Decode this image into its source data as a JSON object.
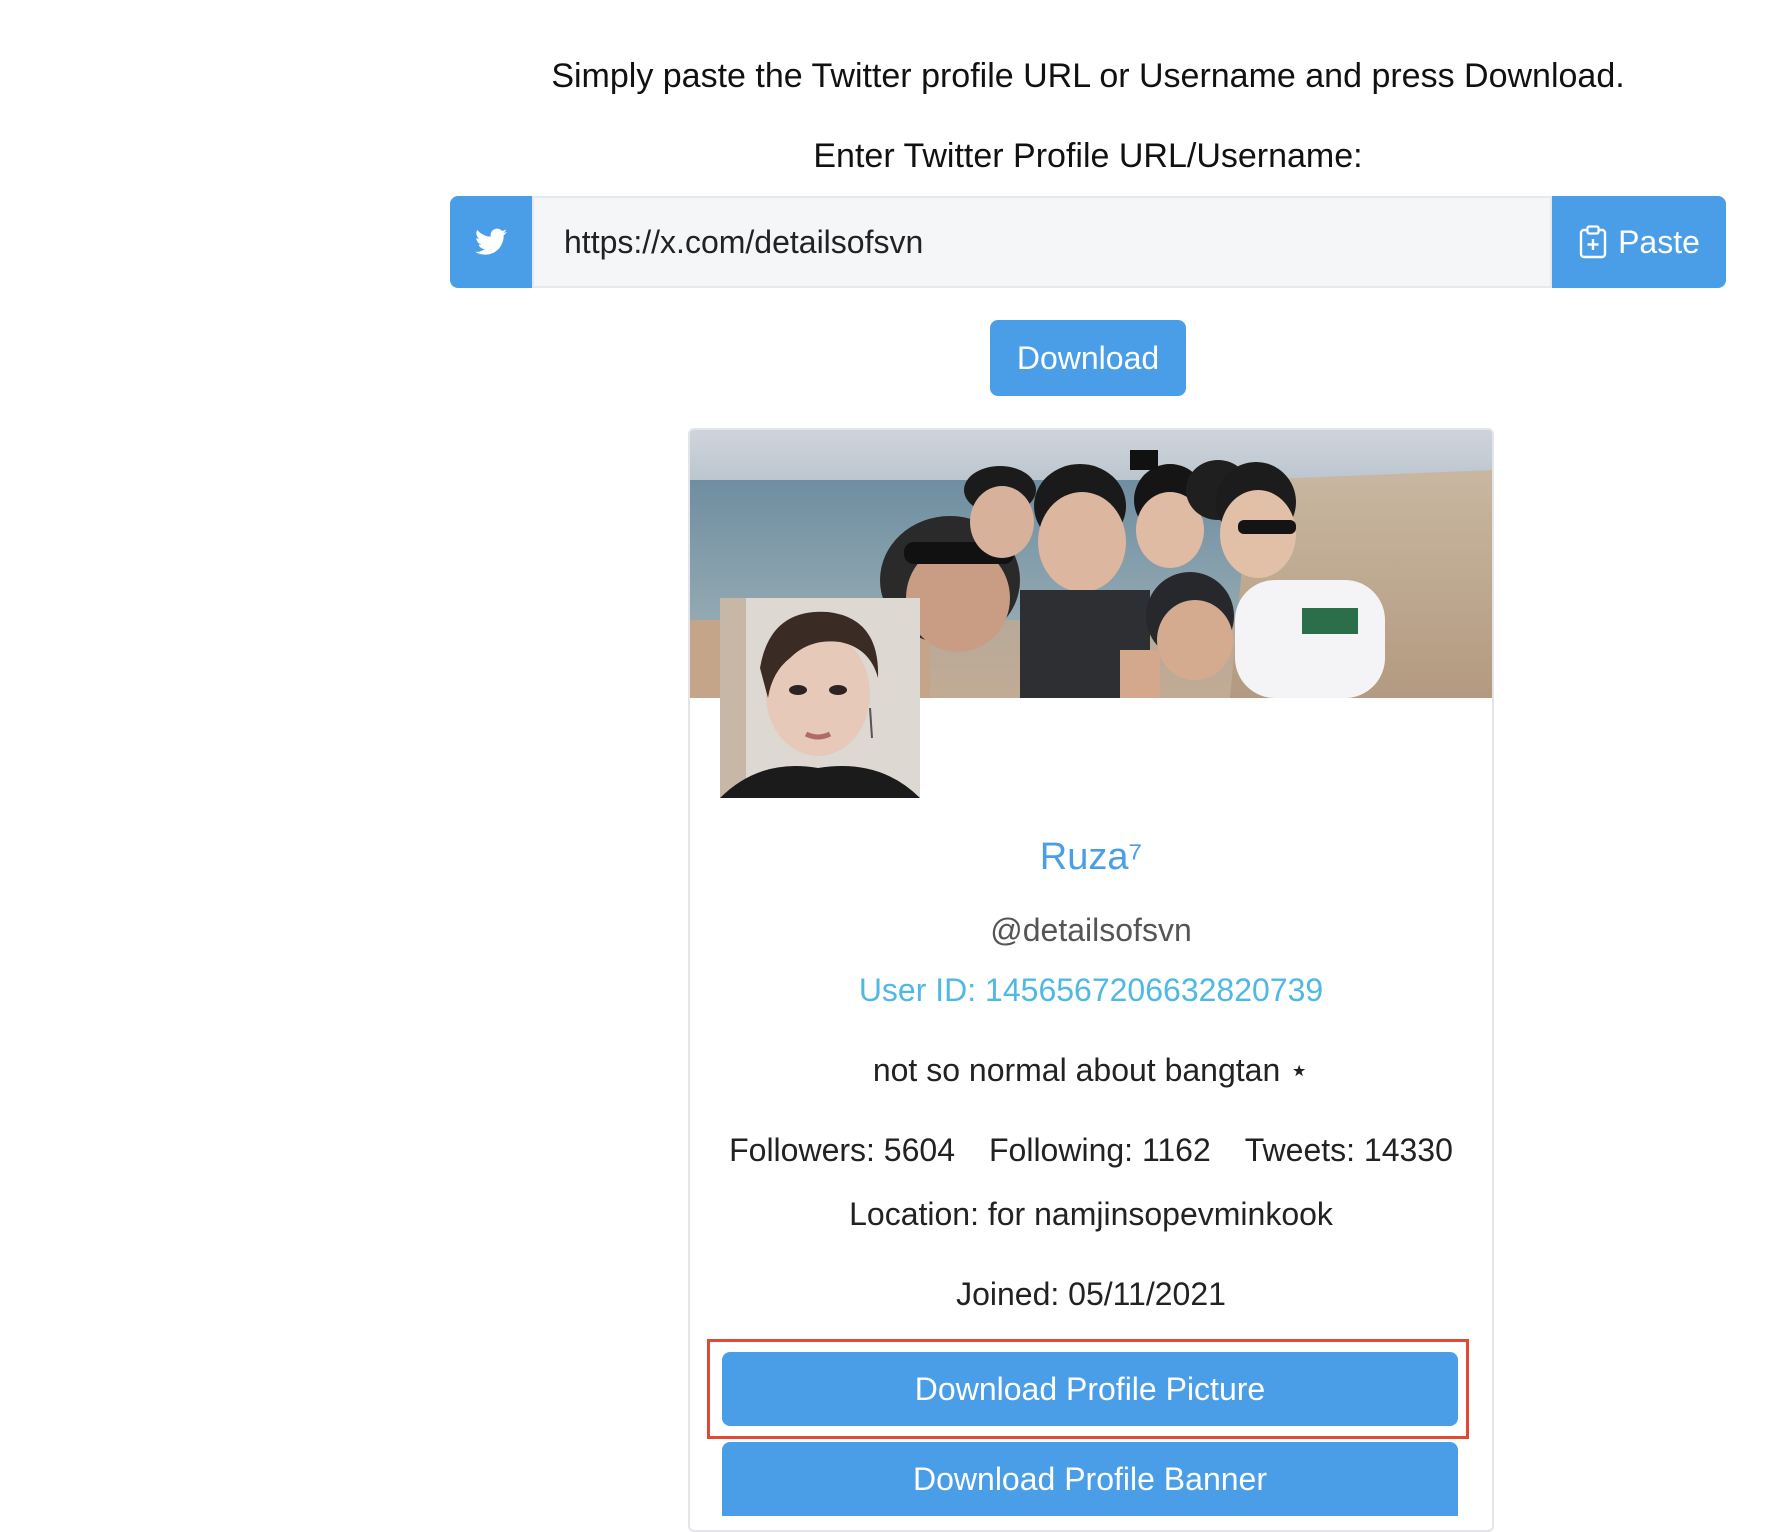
{
  "header": {
    "instruction": "Simply paste the Twitter profile URL or Username and press Download.",
    "input_label": "Enter Twitter Profile URL/Username:"
  },
  "search": {
    "value": "https://x.com/detailsofsvn",
    "twitter_icon": "twitter-bird-icon",
    "paste_label": "Paste",
    "paste_icon": "clipboard-plus-icon",
    "download_label": "Download"
  },
  "profile": {
    "display_name": "Ruza⁷",
    "handle": "@detailsofsvn",
    "user_id": "User ID: 1456567206632820739",
    "bio": "not so normal about bangtan ⋆",
    "followers": "Followers: 5604",
    "following": "Following: 1162",
    "tweets": "Tweets: 14330",
    "location": "Location: for namjinsopevminkook",
    "joined": "Joined: 05/11/2021",
    "download_picture_label": "Download Profile Picture",
    "download_banner_label": "Download Profile Banner"
  },
  "colors": {
    "accent": "#4a9ee8",
    "user_id": "#4fb9e3",
    "highlight": "#e04a34"
  }
}
